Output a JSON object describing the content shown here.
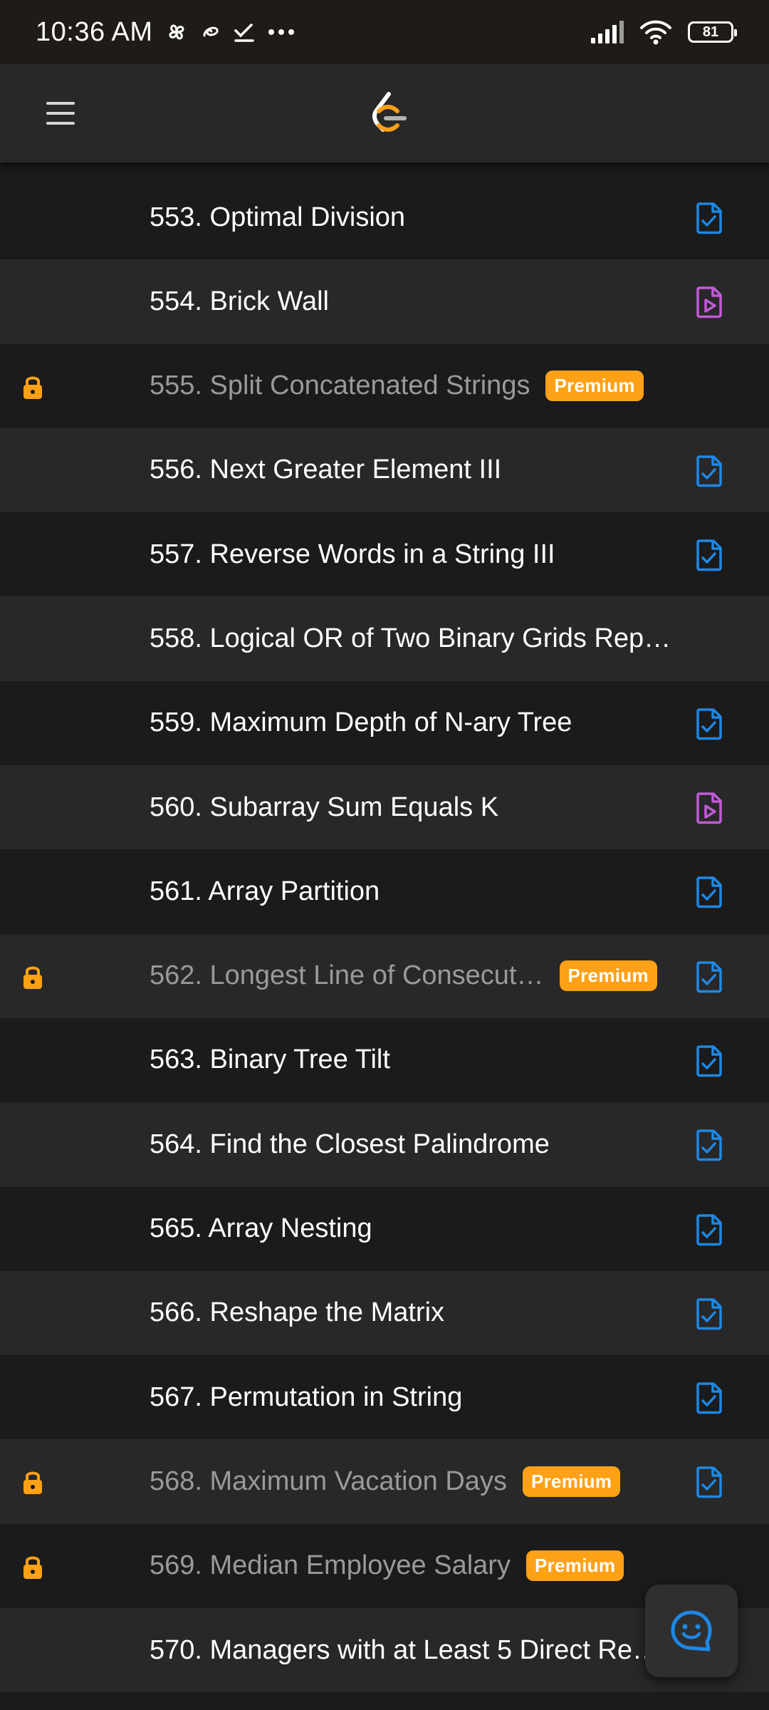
{
  "status_bar": {
    "time": "10:36 AM",
    "battery": "81",
    "icons": [
      "pinwheel-icon",
      "swirl-icon",
      "checkmark-icon",
      "more-dots-icon",
      "signal-icon",
      "wifi-icon",
      "battery-icon"
    ]
  },
  "app_bar": {
    "menu_icon": "hamburger-menu-icon",
    "logo_icon": "leetcode-logo-icon"
  },
  "colors": {
    "accent": "#ffa116",
    "solved": "#1e88e5",
    "video": "#c05bd6",
    "row_dark": "#1b1b1b",
    "row_light": "#282828"
  },
  "premium_label": "Premium",
  "problems": [
    {
      "title": "553. Optimal Division",
      "locked": false,
      "status": "solved"
    },
    {
      "title": "554. Brick Wall",
      "locked": false,
      "status": "video"
    },
    {
      "title": "555. Split Concatenated Strings",
      "locked": true,
      "status": "none"
    },
    {
      "title": "556. Next Greater Element III",
      "locked": false,
      "status": "solved"
    },
    {
      "title": "557. Reverse Words in a String III",
      "locked": false,
      "status": "solved"
    },
    {
      "title": "558. Logical OR of Two Binary Grids Rep…",
      "locked": false,
      "status": "none"
    },
    {
      "title": "559. Maximum Depth of N-ary Tree",
      "locked": false,
      "status": "solved"
    },
    {
      "title": "560. Subarray Sum Equals K",
      "locked": false,
      "status": "video"
    },
    {
      "title": "561. Array Partition",
      "locked": false,
      "status": "solved"
    },
    {
      "title": "562. Longest Line of Consecut…",
      "locked": true,
      "status": "solved"
    },
    {
      "title": "563. Binary Tree Tilt",
      "locked": false,
      "status": "solved"
    },
    {
      "title": "564. Find the Closest Palindrome",
      "locked": false,
      "status": "solved"
    },
    {
      "title": "565. Array Nesting",
      "locked": false,
      "status": "solved"
    },
    {
      "title": "566. Reshape the Matrix",
      "locked": false,
      "status": "solved"
    },
    {
      "title": "567. Permutation in String",
      "locked": false,
      "status": "solved"
    },
    {
      "title": "568. Maximum Vacation Days",
      "locked": true,
      "status": "solved"
    },
    {
      "title": "569. Median Employee Salary",
      "locked": true,
      "status": "none"
    },
    {
      "title": "570. Managers with at Least 5 Direct Re…",
      "locked": false,
      "status": "none"
    }
  ],
  "fab": {
    "icon": "chat-smile-icon"
  }
}
